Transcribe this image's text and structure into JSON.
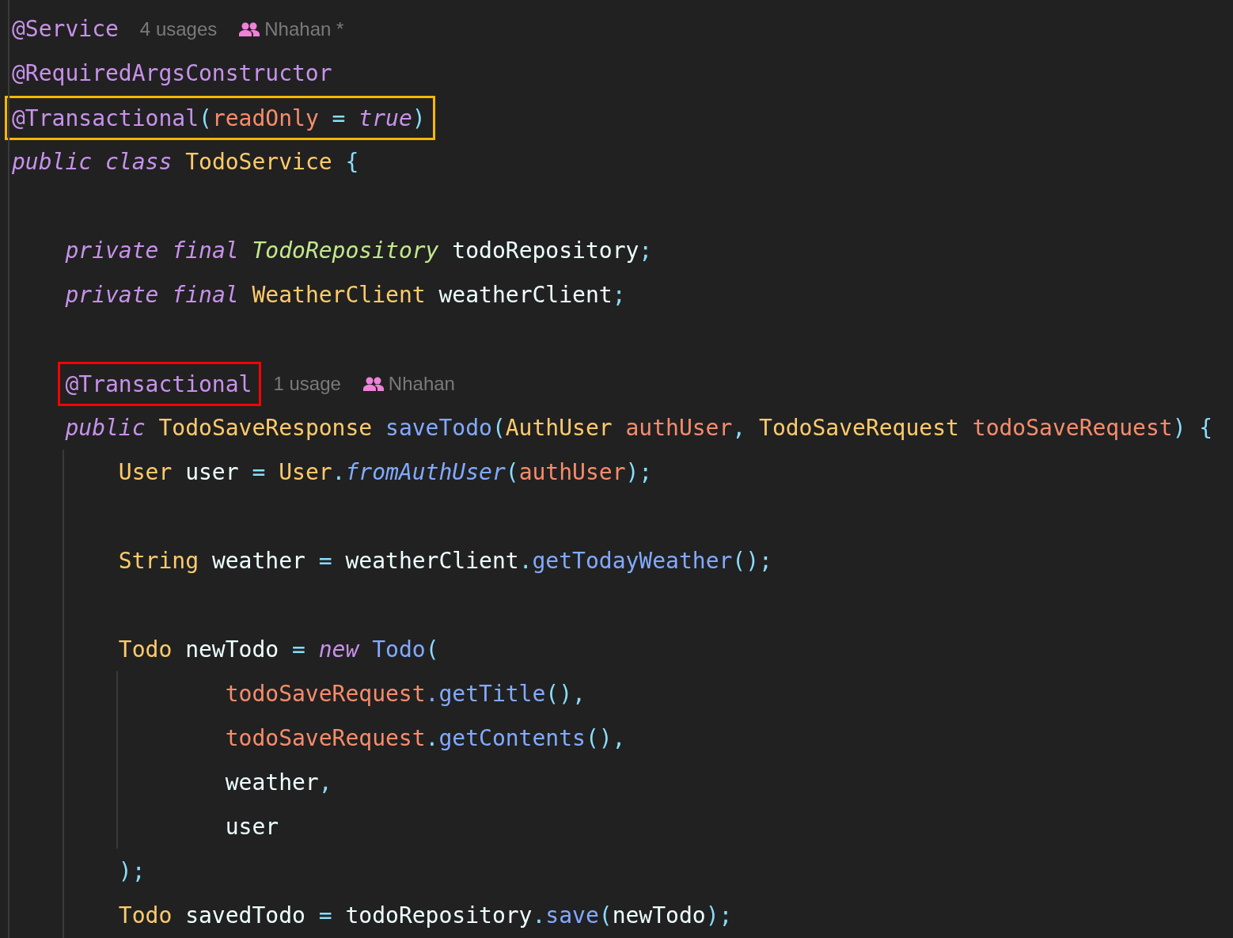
{
  "editor": {
    "lines": [
      {
        "kind": "code",
        "tokens": [
          {
            "kind": "annotation",
            "text": "@Service"
          }
        ],
        "hints": [
          {
            "kind": "usages",
            "text": "4 usages"
          },
          {
            "kind": "author",
            "text": "Nhahan *"
          }
        ]
      },
      {
        "kind": "code",
        "tokens": [
          {
            "kind": "annotation",
            "text": "@RequiredArgsConstructor"
          }
        ]
      },
      {
        "kind": "code",
        "color": "#f5b700",
        "tokens": [
          {
            "kind": "annotation",
            "text": "@Transactional"
          },
          {
            "kind": "punct",
            "text": "("
          },
          {
            "kind": "param",
            "text": "readOnly "
          },
          {
            "kind": "punct",
            "text": "= "
          },
          {
            "kind": "keyword",
            "text": "true"
          },
          {
            "kind": "punct",
            "text": ")"
          }
        ]
      },
      {
        "kind": "code",
        "tokens": [
          {
            "kind": "keyword",
            "text": "public "
          },
          {
            "kind": "keyword",
            "text": "class "
          },
          {
            "kind": "class",
            "text": "TodoService "
          },
          {
            "kind": "punct",
            "text": "{"
          }
        ]
      },
      {
        "kind": "blank"
      },
      {
        "kind": "code",
        "tokens": [
          {
            "kind": "keyword",
            "text": "    private "
          },
          {
            "kind": "keyword",
            "text": "final "
          },
          {
            "kind": "interface",
            "text": "TodoRepository "
          },
          {
            "kind": "plain",
            "text": "todoRepository"
          },
          {
            "kind": "punct",
            "text": ";"
          }
        ]
      },
      {
        "kind": "code",
        "tokens": [
          {
            "kind": "keyword",
            "text": "    private "
          },
          {
            "kind": "keyword",
            "text": "final "
          },
          {
            "kind": "class",
            "text": "WeatherClient "
          },
          {
            "kind": "plain",
            "text": "weatherClient"
          },
          {
            "kind": "punct",
            "text": ";"
          }
        ]
      },
      {
        "kind": "blank"
      },
      {
        "kind": "code",
        "color": "#ff0000",
        "tokens": [
          {
            "kind": "annotation",
            "text": "    @Transactional"
          }
        ],
        "hints": [
          {
            "kind": "usages",
            "text": "1 usage"
          },
          {
            "kind": "author",
            "text": "Nhahan"
          }
        ]
      },
      {
        "kind": "code",
        "tokens": [
          {
            "kind": "keyword",
            "text": "    public "
          },
          {
            "kind": "class",
            "text": "TodoSaveResponse "
          },
          {
            "kind": "method",
            "text": "saveTodo"
          },
          {
            "kind": "punct",
            "text": "("
          },
          {
            "kind": "class",
            "text": "AuthUser "
          },
          {
            "kind": "param",
            "text": "authUser"
          },
          {
            "kind": "punct",
            "text": ", "
          },
          {
            "kind": "class",
            "text": "TodoSaveRequest "
          },
          {
            "kind": "param",
            "text": "todoSaveRequest"
          },
          {
            "kind": "punct",
            "text": ") {"
          }
        ]
      },
      {
        "kind": "code",
        "tokens": [
          {
            "kind": "class",
            "text": "        User "
          },
          {
            "kind": "plain",
            "text": "user "
          },
          {
            "kind": "punct",
            "text": "= "
          },
          {
            "kind": "class",
            "text": "User"
          },
          {
            "kind": "punct",
            "text": "."
          },
          {
            "kind": "static_method",
            "text": "fromAuthUser"
          },
          {
            "kind": "punct",
            "text": "("
          },
          {
            "kind": "param",
            "text": "authUser"
          },
          {
            "kind": "punct",
            "text": ");"
          }
        ]
      },
      {
        "kind": "blank"
      },
      {
        "kind": "code",
        "tokens": [
          {
            "kind": "class",
            "text": "        String "
          },
          {
            "kind": "plain",
            "text": "weather "
          },
          {
            "kind": "punct",
            "text": "= "
          },
          {
            "kind": "plain",
            "text": "weatherClient"
          },
          {
            "kind": "punct",
            "text": "."
          },
          {
            "kind": "method",
            "text": "getTodayWeather"
          },
          {
            "kind": "punct",
            "text": "();"
          }
        ]
      },
      {
        "kind": "blank"
      },
      {
        "kind": "code",
        "tokens": [
          {
            "kind": "class",
            "text": "        Todo "
          },
          {
            "kind": "plain",
            "text": "newTodo "
          },
          {
            "kind": "punct",
            "text": "= "
          },
          {
            "kind": "keyword",
            "text": "new "
          },
          {
            "kind": "method",
            "text": "Todo"
          },
          {
            "kind": "punct",
            "text": "("
          }
        ]
      },
      {
        "kind": "code",
        "tokens": [
          {
            "kind": "param",
            "text": "                todoSaveRequest"
          },
          {
            "kind": "method",
            "text": ".getTitle"
          },
          {
            "kind": "punct",
            "text": "(),"
          }
        ]
      },
      {
        "kind": "code",
        "tokens": [
          {
            "kind": "param",
            "text": "                todoSaveRequest"
          },
          {
            "kind": "punct",
            "text": "."
          },
          {
            "kind": "method",
            "text": "getContents"
          },
          {
            "kind": "punct",
            "text": "(),"
          }
        ]
      },
      {
        "kind": "code",
        "tokens": [
          {
            "kind": "plain",
            "text": "                weather"
          },
          {
            "kind": "punct",
            "text": ","
          }
        ]
      },
      {
        "kind": "code",
        "tokens": [
          {
            "kind": "plain",
            "text": "                user"
          }
        ]
      },
      {
        "kind": "code",
        "tokens": [
          {
            "kind": "punct",
            "text": "        );"
          }
        ]
      },
      {
        "kind": "code",
        "tokens": [
          {
            "kind": "class",
            "text": "        Todo "
          },
          {
            "kind": "plain",
            "text": "savedTodo "
          },
          {
            "kind": "punct",
            "text": "= "
          },
          {
            "kind": "plain",
            "text": "todoRepository"
          },
          {
            "kind": "punct",
            "text": "."
          },
          {
            "kind": "method",
            "text": "save"
          },
          {
            "kind": "punct",
            "text": "("
          },
          {
            "kind": "plain",
            "text": "newTodo"
          },
          {
            "kind": "punct",
            "text": ");"
          }
        ]
      }
    ]
  }
}
